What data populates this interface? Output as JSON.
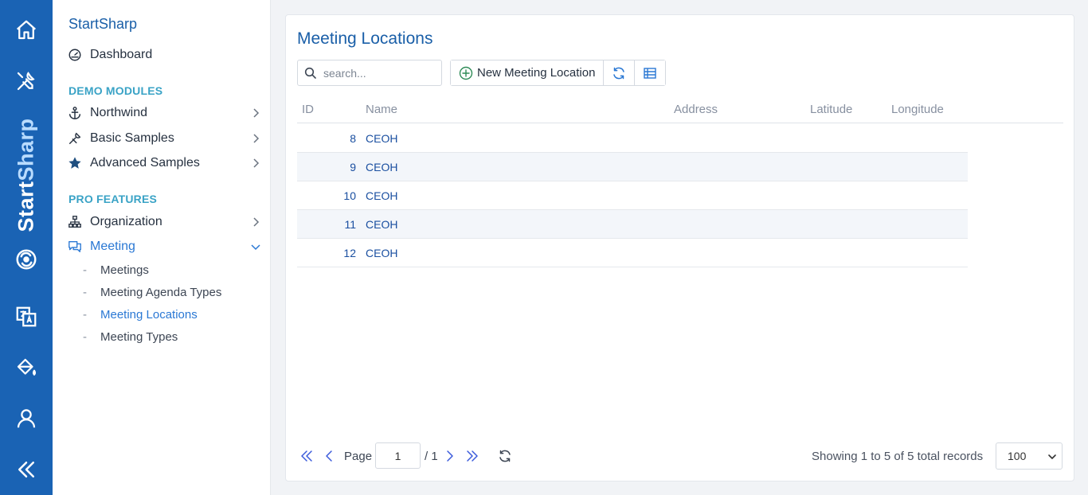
{
  "rail": {
    "brand_a": "Start",
    "brand_b": "Sharp",
    "icons": [
      "home-icon",
      "tools-icon",
      "logo-icon",
      "translate-icon",
      "paint-bucket-icon",
      "user-icon",
      "collapse-icon"
    ]
  },
  "sidebar": {
    "title": "StartSharp",
    "dashboard": "Dashboard",
    "section_demo": "DEMO MODULES",
    "northwind": "Northwind",
    "basic_samples": "Basic Samples",
    "advanced_samples": "Advanced Samples",
    "section_pro": "PRO FEATURES",
    "organization": "Organization",
    "meeting": "Meeting",
    "sub": {
      "dash": "-",
      "meetings": "Meetings",
      "agenda_types": "Meeting Agenda Types",
      "locations": "Meeting Locations",
      "types": "Meeting Types"
    }
  },
  "main": {
    "title": "Meeting Locations",
    "search_placeholder": "search...",
    "new_button": "New Meeting Location",
    "columns": {
      "id": "ID",
      "name": "Name",
      "address": "Address",
      "latitude": "Latitude",
      "longitude": "Longitude"
    },
    "rows": [
      {
        "id": "8",
        "name": "CEOH",
        "address": "",
        "latitude": "",
        "longitude": ""
      },
      {
        "id": "9",
        "name": "CEOH",
        "address": "",
        "latitude": "",
        "longitude": ""
      },
      {
        "id": "10",
        "name": "CEOH",
        "address": "",
        "latitude": "",
        "longitude": ""
      },
      {
        "id": "11",
        "name": "CEOH",
        "address": "",
        "latitude": "",
        "longitude": ""
      },
      {
        "id": "12",
        "name": "CEOH",
        "address": "",
        "latitude": "",
        "longitude": ""
      }
    ]
  },
  "pager": {
    "page_label": "Page",
    "page_value": "1",
    "total": "/ 1",
    "info": "Showing 1 to 5 of 5 total records",
    "page_size": "100"
  },
  "colors": {
    "rail": "#1a63b4",
    "accent": "#1a5fa8",
    "section": "#3aa3c6",
    "link": "#1a4fa0"
  }
}
